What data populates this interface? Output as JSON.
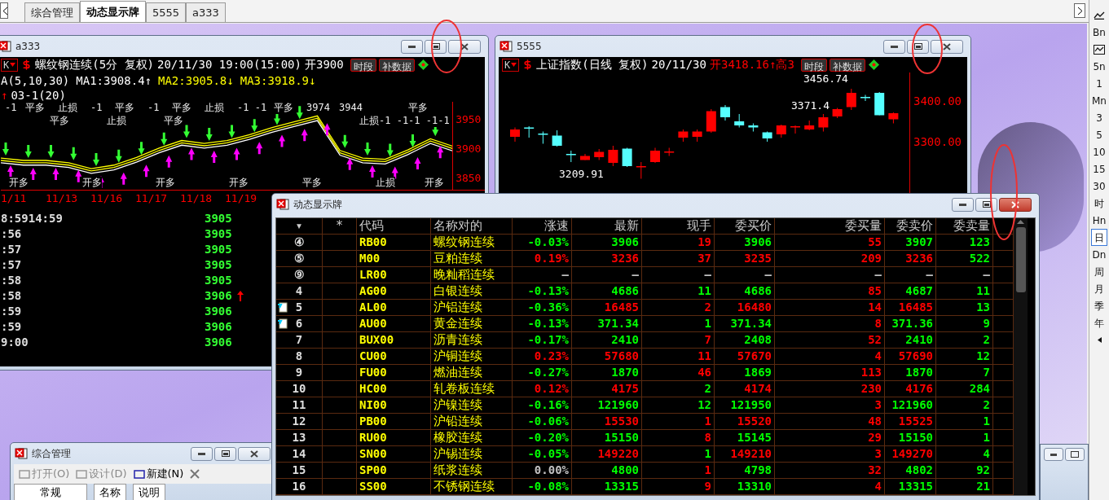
{
  "tabs": [
    {
      "label": "综合管理",
      "selected": false
    },
    {
      "label": "动态显示牌",
      "selected": true
    },
    {
      "label": "5555",
      "selected": false
    },
    {
      "label": "a333",
      "selected": false
    }
  ],
  "period_bar": {
    "items": [
      {
        "kind": "trend",
        "selected": false
      },
      {
        "kind": "text",
        "label": "Bn",
        "selected": false
      },
      {
        "kind": "wave",
        "selected": false
      },
      {
        "kind": "text",
        "label": "5n",
        "selected": false
      },
      {
        "kind": "text",
        "label": "1",
        "selected": false
      },
      {
        "kind": "text",
        "label": "Mn",
        "selected": false
      },
      {
        "kind": "text",
        "label": "3",
        "selected": false
      },
      {
        "kind": "text",
        "label": "5",
        "selected": false
      },
      {
        "kind": "text",
        "label": "10",
        "selected": false
      },
      {
        "kind": "text",
        "label": "15",
        "selected": false
      },
      {
        "kind": "text",
        "label": "30",
        "selected": false
      },
      {
        "kind": "text",
        "label": "时",
        "selected": false
      },
      {
        "kind": "text",
        "label": "Hn",
        "selected": false
      },
      {
        "kind": "text",
        "label": "日",
        "selected": true
      },
      {
        "kind": "text",
        "label": "Dn",
        "selected": false
      },
      {
        "kind": "text",
        "label": "周",
        "selected": false
      },
      {
        "kind": "text",
        "label": "月",
        "selected": false
      },
      {
        "kind": "text",
        "label": "季",
        "selected": false
      },
      {
        "kind": "text",
        "label": "年",
        "selected": false
      },
      {
        "kind": "collapse",
        "selected": false
      }
    ]
  },
  "chart_window_1": {
    "title": "a333",
    "period_button": "K",
    "symbol": "螺纹钢连续(5分 复权)",
    "datetime": "20/11/30 19:00(15:00)",
    "open": "开3900",
    "buttons": [
      "时段",
      "补数据"
    ],
    "ma": {
      "label": "A(5,10,30)",
      "ma1": "MA1:3908.4↑",
      "ma2": "MA2:3905.8↓",
      "ma3": "MA3:3918.9↓"
    },
    "indicator_arrow": "↑",
    "indicator": "03-1(20)",
    "chart_data": {
      "type": "line",
      "ylim": [
        3830,
        3980
      ],
      "yticks": [
        {
          "value": 3950,
          "label": "3950"
        },
        {
          "value": 3900,
          "label": "3900"
        },
        {
          "value": 3850,
          "label": "3850"
        }
      ],
      "series": [
        {
          "color": "#ffffff",
          "values": [
            3876,
            3872,
            3872,
            3868,
            3858,
            3864,
            3877,
            3893,
            3906,
            3901,
            3906,
            3916,
            3928,
            3938,
            3948,
            3889,
            3876,
            3874,
            3890,
            3909,
            3896
          ]
        },
        {
          "color": "#ffff00",
          "values": [
            3880,
            3876,
            3876,
            3872,
            3862,
            3868,
            3881,
            3897,
            3910,
            3905,
            3910,
            3920,
            3932,
            3942,
            3952,
            3893,
            3880,
            3878,
            3894,
            3913,
            3900
          ]
        },
        {
          "color": "#ffff00",
          "values": [
            3884,
            3880,
            3880,
            3876,
            3866,
            3872,
            3885,
            3901,
            3914,
            3909,
            3914,
            3924,
            3936,
            3946,
            3956,
            3897,
            3884,
            3882,
            3898,
            3917,
            3904
          ]
        }
      ]
    },
    "signal_labels": [
      "-1",
      "平多",
      "止损",
      "-1",
      "平多",
      "-1",
      "平多",
      "止损",
      "-1 -1",
      "平多",
      "3974",
      "3944",
      "平多",
      "平多",
      "止损",
      "平多",
      "止损-1 -1-1 -1-1",
      "开多",
      "开多",
      "开多",
      "开多",
      "平多",
      "止损",
      "开多"
    ],
    "date_labels": [
      "1/11",
      "11/13",
      "11/16",
      "11/17",
      "11/18",
      "11/19"
    ],
    "ticks": [
      {
        "time": "8:5914:59",
        "price": "3905",
        "up": false
      },
      {
        "time": ":56",
        "price": "3905",
        "up": false
      },
      {
        "time": ":57",
        "price": "3905",
        "up": false
      },
      {
        "time": ":57",
        "price": "3905",
        "up": false
      },
      {
        "time": ":58",
        "price": "3905",
        "up": false
      },
      {
        "time": ":58",
        "price": "3906",
        "up": true
      },
      {
        "time": ":59",
        "price": "3906",
        "up": false
      },
      {
        "time": ":59",
        "price": "3906",
        "up": false
      },
      {
        "time": "9:00",
        "price": "3906",
        "up": false
      }
    ]
  },
  "chart_window_2": {
    "title": "5555",
    "period_button": "K",
    "symbol": "上证指数(日线 复权)",
    "date": "20/11/30",
    "open": "开3418.16↑高3",
    "buttons": [
      "时段",
      "补数据"
    ],
    "chart_data": {
      "type": "candlestick",
      "ylim": [
        3170,
        3470
      ],
      "yticks": [
        {
          "value": 3400,
          "label": "3400.00"
        },
        {
          "value": 3300,
          "label": "3300.00"
        }
      ],
      "ohlc": [
        [
          3312,
          3335,
          3300,
          3330
        ],
        [
          3335,
          3338,
          3310,
          3332
        ],
        [
          3320,
          3325,
          3295,
          3318
        ],
        [
          3315,
          3328,
          3288,
          3290
        ],
        [
          3270,
          3278,
          3250,
          3268
        ],
        [
          3255,
          3270,
          3255,
          3265
        ],
        [
          3262,
          3282,
          3255,
          3275
        ],
        [
          3248,
          3290,
          3240,
          3280
        ],
        [
          3283,
          3285,
          3238,
          3240
        ],
        [
          3238,
          3250,
          3209,
          3240
        ],
        [
          3250,
          3285,
          3248,
          3278
        ],
        [
          3275,
          3285,
          3265,
          3276
        ],
        [
          3310,
          3330,
          3300,
          3325
        ],
        [
          3312,
          3330,
          3300,
          3325
        ],
        [
          3325,
          3380,
          3322,
          3375
        ],
        [
          3385,
          3390,
          3352,
          3360
        ],
        [
          3350,
          3368,
          3335,
          3340
        ],
        [
          3340,
          3345,
          3325,
          3335
        ],
        [
          3323,
          3325,
          3300,
          3308
        ],
        [
          3318,
          3342,
          3310,
          3340
        ],
        [
          3335,
          3340,
          3320,
          3338
        ],
        [
          3330,
          3352,
          3328,
          3340
        ],
        [
          3335,
          3368,
          3325,
          3360
        ],
        [
          3362,
          3383,
          3358,
          3380
        ],
        [
          3385,
          3430,
          3378,
          3420
        ],
        [
          3410,
          3415,
          3400,
          3408
        ],
        [
          3420,
          3422,
          3365,
          3365
        ],
        [
          3355,
          3372,
          3345,
          3370
        ]
      ]
    },
    "annotations": [
      "3456.74",
      "3371.4",
      "3209.91"
    ]
  },
  "board": {
    "title": "动态显示牌",
    "columns": [
      "▾",
      "*",
      "代码",
      "名称对的",
      "涨速",
      "最新",
      "现手",
      "委买价",
      "委买量",
      "委卖价",
      "委卖量"
    ],
    "rows": [
      {
        "note": false,
        "cells": [
          {
            "text": "④"
          },
          {
            "text": ""
          },
          {
            "text": "RB00"
          },
          {
            "text": "螺纹钢连续"
          },
          {
            "text": "-0.03%",
            "color": "#00ff00"
          },
          {
            "text": "3906",
            "color": "#00ff00"
          },
          {
            "text": "19",
            "color": "#ff0000"
          },
          {
            "text": "3906",
            "color": "#00ff00"
          },
          {
            "text": "55",
            "color": "#ff0000"
          },
          {
            "text": "3907",
            "color": "#00ff00"
          },
          {
            "text": "123",
            "color": "#00ff00"
          }
        ]
      },
      {
        "note": false,
        "cells": [
          {
            "text": "⑤"
          },
          {
            "text": ""
          },
          {
            "text": "M00"
          },
          {
            "text": "豆粕连续"
          },
          {
            "text": "0.19%",
            "color": "#ff0000"
          },
          {
            "text": "3236",
            "color": "#ff0000"
          },
          {
            "text": "37",
            "color": "#ff0000"
          },
          {
            "text": "3235",
            "color": "#ff0000"
          },
          {
            "text": "209",
            "color": "#ff0000"
          },
          {
            "text": "3236",
            "color": "#ff0000"
          },
          {
            "text": "522",
            "color": "#00ff00"
          }
        ]
      },
      {
        "note": false,
        "cells": [
          {
            "text": "⑨"
          },
          {
            "text": ""
          },
          {
            "text": "LR00"
          },
          {
            "text": "晚籼稻连续"
          },
          {
            "text": "—",
            "color": "#c0c0c0"
          },
          {
            "text": "—",
            "color": "#c0c0c0"
          },
          {
            "text": "—",
            "color": "#c0c0c0"
          },
          {
            "text": "—",
            "color": "#c0c0c0"
          },
          {
            "text": "—",
            "color": "#c0c0c0"
          },
          {
            "text": "—",
            "color": "#c0c0c0"
          },
          {
            "text": "—",
            "color": "#c0c0c0"
          }
        ]
      },
      {
        "note": false,
        "cells": [
          {
            "text": "4"
          },
          {
            "text": ""
          },
          {
            "text": "AG00"
          },
          {
            "text": "白银连续"
          },
          {
            "text": "-0.13%",
            "color": "#00ff00"
          },
          {
            "text": "4686",
            "color": "#00ff00"
          },
          {
            "text": "11",
            "color": "#00ff00"
          },
          {
            "text": "4686",
            "color": "#00ff00"
          },
          {
            "text": "85",
            "color": "#ff0000"
          },
          {
            "text": "4687",
            "color": "#00ff00"
          },
          {
            "text": "11",
            "color": "#00ff00"
          }
        ]
      },
      {
        "note": true,
        "cells": [
          {
            "text": "5"
          },
          {
            "text": ""
          },
          {
            "text": "AL00"
          },
          {
            "text": "沪铝连续"
          },
          {
            "text": "-0.36%",
            "color": "#00ff00"
          },
          {
            "text": "16485",
            "color": "#ff0000"
          },
          {
            "text": "2",
            "color": "#ff0000"
          },
          {
            "text": "16480",
            "color": "#ff0000"
          },
          {
            "text": "14",
            "color": "#ff0000"
          },
          {
            "text": "16485",
            "color": "#ff0000"
          },
          {
            "text": "13",
            "color": "#00ff00"
          }
        ]
      },
      {
        "note": true,
        "cells": [
          {
            "text": "6"
          },
          {
            "text": ""
          },
          {
            "text": "AU00"
          },
          {
            "text": "黄金连续"
          },
          {
            "text": "-0.13%",
            "color": "#00ff00"
          },
          {
            "text": "371.34",
            "color": "#00ff00"
          },
          {
            "text": "1",
            "color": "#00ff00"
          },
          {
            "text": "371.34",
            "color": "#00ff00"
          },
          {
            "text": "8",
            "color": "#ff0000"
          },
          {
            "text": "371.36",
            "color": "#00ff00"
          },
          {
            "text": "9",
            "color": "#00ff00"
          }
        ]
      },
      {
        "note": false,
        "cells": [
          {
            "text": "7"
          },
          {
            "text": ""
          },
          {
            "text": "BUX00"
          },
          {
            "text": "沥青连续"
          },
          {
            "text": "-0.17%",
            "color": "#00ff00"
          },
          {
            "text": "2410",
            "color": "#00ff00"
          },
          {
            "text": "7",
            "color": "#ff0000"
          },
          {
            "text": "2408",
            "color": "#00ff00"
          },
          {
            "text": "52",
            "color": "#ff0000"
          },
          {
            "text": "2410",
            "color": "#00ff00"
          },
          {
            "text": "2",
            "color": "#00ff00"
          }
        ]
      },
      {
        "note": false,
        "cells": [
          {
            "text": "8"
          },
          {
            "text": ""
          },
          {
            "text": "CU00"
          },
          {
            "text": "沪铜连续"
          },
          {
            "text": "0.23%",
            "color": "#ff0000"
          },
          {
            "text": "57680",
            "color": "#ff0000"
          },
          {
            "text": "11",
            "color": "#ff0000"
          },
          {
            "text": "57670",
            "color": "#ff0000"
          },
          {
            "text": "4",
            "color": "#ff0000"
          },
          {
            "text": "57690",
            "color": "#ff0000"
          },
          {
            "text": "12",
            "color": "#00ff00"
          }
        ]
      },
      {
        "note": false,
        "cells": [
          {
            "text": "9"
          },
          {
            "text": ""
          },
          {
            "text": "FU00"
          },
          {
            "text": "燃油连续"
          },
          {
            "text": "-0.27%",
            "color": "#00ff00"
          },
          {
            "text": "1870",
            "color": "#00ff00"
          },
          {
            "text": "46",
            "color": "#ff0000"
          },
          {
            "text": "1869",
            "color": "#00ff00"
          },
          {
            "text": "113",
            "color": "#ff0000"
          },
          {
            "text": "1870",
            "color": "#00ff00"
          },
          {
            "text": "7",
            "color": "#00ff00"
          }
        ]
      },
      {
        "note": false,
        "cells": [
          {
            "text": "10"
          },
          {
            "text": ""
          },
          {
            "text": "HC00"
          },
          {
            "text": "轧卷板连续"
          },
          {
            "text": "0.12%",
            "color": "#ff0000"
          },
          {
            "text": "4175",
            "color": "#ff0000"
          },
          {
            "text": "2",
            "color": "#00ff00"
          },
          {
            "text": "4174",
            "color": "#ff0000"
          },
          {
            "text": "230",
            "color": "#ff0000"
          },
          {
            "text": "4176",
            "color": "#ff0000"
          },
          {
            "text": "284",
            "color": "#00ff00"
          }
        ]
      },
      {
        "note": false,
        "cells": [
          {
            "text": "11"
          },
          {
            "text": ""
          },
          {
            "text": "NI00"
          },
          {
            "text": "沪镍连续"
          },
          {
            "text": "-0.16%",
            "color": "#00ff00"
          },
          {
            "text": "121960",
            "color": "#00ff00"
          },
          {
            "text": "12",
            "color": "#00ff00"
          },
          {
            "text": "121950",
            "color": "#00ff00"
          },
          {
            "text": "3",
            "color": "#ff0000"
          },
          {
            "text": "121960",
            "color": "#00ff00"
          },
          {
            "text": "2",
            "color": "#00ff00"
          }
        ]
      },
      {
        "note": false,
        "cells": [
          {
            "text": "12"
          },
          {
            "text": ""
          },
          {
            "text": "PB00"
          },
          {
            "text": "沪铅连续"
          },
          {
            "text": "-0.06%",
            "color": "#00ff00"
          },
          {
            "text": "15530",
            "color": "#ff0000"
          },
          {
            "text": "1",
            "color": "#ff0000"
          },
          {
            "text": "15520",
            "color": "#ff0000"
          },
          {
            "text": "48",
            "color": "#ff0000"
          },
          {
            "text": "15525",
            "color": "#ff0000"
          },
          {
            "text": "1",
            "color": "#00ff00"
          }
        ]
      },
      {
        "note": false,
        "cells": [
          {
            "text": "13"
          },
          {
            "text": ""
          },
          {
            "text": "RU00"
          },
          {
            "text": "橡胶连续"
          },
          {
            "text": "-0.20%",
            "color": "#00ff00"
          },
          {
            "text": "15150",
            "color": "#00ff00"
          },
          {
            "text": "8",
            "color": "#ff0000"
          },
          {
            "text": "15145",
            "color": "#00ff00"
          },
          {
            "text": "29",
            "color": "#ff0000"
          },
          {
            "text": "15150",
            "color": "#00ff00"
          },
          {
            "text": "1",
            "color": "#00ff00"
          }
        ]
      },
      {
        "note": false,
        "cells": [
          {
            "text": "14"
          },
          {
            "text": ""
          },
          {
            "text": "SN00"
          },
          {
            "text": "沪锡连续"
          },
          {
            "text": "-0.05%",
            "color": "#00ff00"
          },
          {
            "text": "149220",
            "color": "#ff0000"
          },
          {
            "text": "1",
            "color": "#00ff00"
          },
          {
            "text": "149210",
            "color": "#ff0000"
          },
          {
            "text": "3",
            "color": "#ff0000"
          },
          {
            "text": "149270",
            "color": "#ff0000"
          },
          {
            "text": "4",
            "color": "#00ff00"
          }
        ]
      },
      {
        "note": false,
        "cells": [
          {
            "text": "15"
          },
          {
            "text": ""
          },
          {
            "text": "SP00"
          },
          {
            "text": "纸浆连续"
          },
          {
            "text": "0.00%",
            "color": "#c0c0c0"
          },
          {
            "text": "4800",
            "color": "#00ff00"
          },
          {
            "text": "1",
            "color": "#ff0000"
          },
          {
            "text": "4798",
            "color": "#00ff00"
          },
          {
            "text": "32",
            "color": "#ff0000"
          },
          {
            "text": "4802",
            "color": "#00ff00"
          },
          {
            "text": "92",
            "color": "#00ff00"
          }
        ]
      },
      {
        "note": false,
        "cells": [
          {
            "text": "16"
          },
          {
            "text": ""
          },
          {
            "text": "SS00"
          },
          {
            "text": "不锈钢连续"
          },
          {
            "text": "-0.08%",
            "color": "#00ff00"
          },
          {
            "text": "13315",
            "color": "#00ff00"
          },
          {
            "text": "9",
            "color": "#ff0000"
          },
          {
            "text": "13310",
            "color": "#00ff00"
          },
          {
            "text": "4",
            "color": "#ff0000"
          },
          {
            "text": "13315",
            "color": "#00ff00"
          },
          {
            "text": "21",
            "color": "#00ff00"
          }
        ]
      }
    ]
  },
  "manager_window": {
    "title": "综合管理",
    "toolbar": [
      {
        "label": "打开(O)",
        "disabled": true
      },
      {
        "label": "设计(D)",
        "disabled": true
      },
      {
        "label": "新建(N)",
        "disabled": false
      }
    ],
    "tab": "常规",
    "columns": [
      "名称",
      "说明"
    ]
  }
}
